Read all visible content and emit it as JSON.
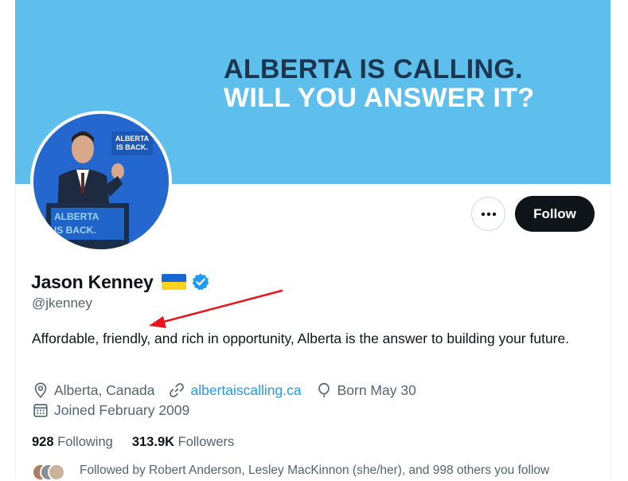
{
  "banner": {
    "line1": "ALBERTA IS CALLING.",
    "line2": "WILL YOU ANSWER IT?",
    "bg_color": "#5fbfec"
  },
  "avatar": {
    "podium_text_1": "ALBERTA",
    "podium_text_2": "IS BACK.",
    "sign_text_1": "ALBERTA",
    "sign_text_2": "IS BACK."
  },
  "actions": {
    "more_icon": "more-horizontal-icon",
    "follow_label": "Follow"
  },
  "profile": {
    "name": "Jason Kenney",
    "flag_icon": "ukraine-flag-icon",
    "verified_icon": "verified-badge-icon",
    "handle": "@jkenney",
    "bio": "Affordable, friendly, and rich in opportunity, Alberta is the answer to building your future.",
    "location": "Alberta, Canada",
    "website": "albertaiscalling.ca",
    "birthday": "Born May 30",
    "joined": "Joined February 2009"
  },
  "stats": {
    "following_count": "928",
    "following_label": "Following",
    "followers_count": "313.9K",
    "followers_label": "Followers"
  },
  "followed_by": "Followed by Robert Anderson, Lesley MacKinnon (she/her), and 998 others you follow",
  "colors": {
    "accent": "#1d9bf0",
    "text_primary": "#0f1419",
    "text_secondary": "#536471",
    "annotation_arrow": "#e8161b"
  }
}
